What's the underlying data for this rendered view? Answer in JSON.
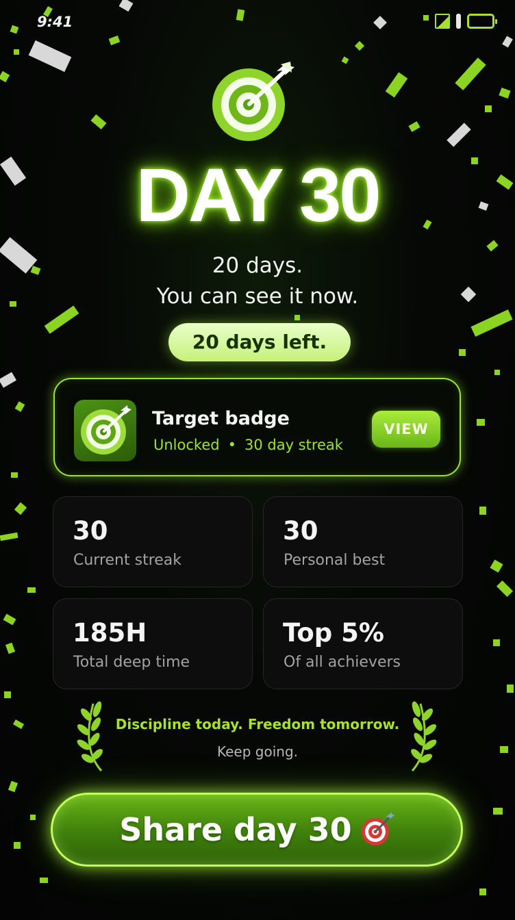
{
  "status_bar": {
    "time": "9:41"
  },
  "hero": {
    "title": "DAY 30",
    "subtitle_line1": "20 days.",
    "subtitle_line2": "You can see it now.",
    "pill": "20 days left."
  },
  "badge": {
    "title": "Target badge",
    "status": "Unlocked",
    "separator": "•",
    "streak": "30 day streak",
    "view_label": "VIEW"
  },
  "stats": [
    {
      "value": "30",
      "label": "Current streak"
    },
    {
      "value": "30",
      "label": "Personal best"
    },
    {
      "value": "185H",
      "label": "Total deep time"
    },
    {
      "value": "Top 5%",
      "label": "Of all achievers"
    }
  ],
  "quote": {
    "main": "Discipline today. Freedom tomorrow.",
    "sub": "Keep going."
  },
  "share": {
    "label": "Share day 30"
  },
  "colors": {
    "accent": "#9be52c",
    "background": "#050705",
    "pill_bg": "#d8f8a6"
  }
}
